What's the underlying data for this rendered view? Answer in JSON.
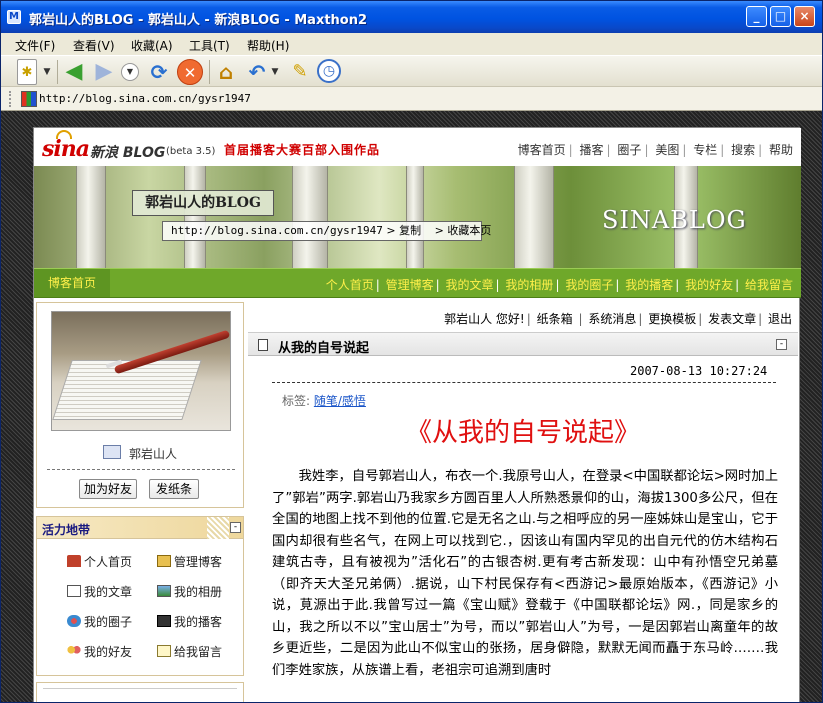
{
  "window": {
    "title": "郭岩山人的BLOG - 郭岩山人 - 新浪BLOG - Maxthon2",
    "app_icon": "maxthon-icon",
    "minimize": "_",
    "maximize": "□",
    "close": "×"
  },
  "menu": [
    "文件(F)",
    "查看(V)",
    "收藏(A)",
    "工具(T)",
    "帮助(H)"
  ],
  "toolbar": {
    "icons": [
      "new-tab-icon",
      "back-icon",
      "forward-icon",
      "dropdown-icon",
      "refresh-icon",
      "stop-icon",
      "home-icon",
      "undo-icon",
      "magic-wand-icon",
      "clock-icon"
    ]
  },
  "address": {
    "url": "http://blog.sina.com.cn/gysr1947"
  },
  "sina": {
    "logo": "sina",
    "product": "新浪 BLOG",
    "beta": "(beta 3.5)",
    "promo": "首届播客大赛百部入围作品",
    "topnav": [
      "博客首页",
      "播客",
      "圈子",
      "美图",
      "专栏",
      "搜索",
      "帮助"
    ]
  },
  "banner": {
    "blog_title": "郭岩山人的BLOG",
    "url": "http://blog.sina.com.cn/gysr1947",
    "copy_label": "> 复制",
    "bookmark_label": "> 收藏本页",
    "brand": "SINABLOG"
  },
  "green_nav": {
    "home": "博客首页",
    "items": [
      "个人首页",
      "管理博客",
      "我的文章",
      "我的相册",
      "我的圈子",
      "我的播客",
      "我的好友",
      "给我留言"
    ]
  },
  "profile": {
    "name": "郭岩山人",
    "add_friend": "加为好友",
    "send_note": "发纸条"
  },
  "huoli": {
    "title": "活力地带",
    "collapse": "-",
    "links": [
      {
        "label": "个人首页",
        "icon": "home-icon"
      },
      {
        "label": "管理博客",
        "icon": "manage-icon"
      },
      {
        "label": "我的文章",
        "icon": "article-icon"
      },
      {
        "label": "我的相册",
        "icon": "photo-icon"
      },
      {
        "label": "我的圈子",
        "icon": "circle-icon"
      },
      {
        "label": "我的播客",
        "icon": "video-icon"
      },
      {
        "label": "我的好友",
        "icon": "friends-icon"
      },
      {
        "label": "给我留言",
        "icon": "message-icon"
      }
    ]
  },
  "userbar": {
    "greeting": "郭岩山人 您好!",
    "items": [
      "纸条箱",
      "系统消息",
      "更换模板",
      "发表文章",
      "退出"
    ]
  },
  "article": {
    "header_title": "从我的自号说起",
    "collapse": "-",
    "date": "2007-08-13 10:27:24",
    "tag_label": "标签:",
    "tag": "随笔/感悟",
    "big_title": "《从我的自号说起》",
    "body": "我姓李，自号郭岩山人，布衣一个.我原号山人，在登录<中国联都论坛>网时加上了”郭岩”两字.郭岩山乃我家乡方圆百里人人所熟悉景仰的山，海拔1300多公尺，但在全国的地图上找不到他的位置.它是无名之山.与之相呼应的另一座姊妹山是宝山，它于国内却很有些名气，在网上可以找到它.，因该山有国内罕见的出自元代的仿木结构石建筑古寺，且有被视为”活化石”的古银杏树.更有考古新发现：山中有孙悟空兄弟墓（即齐天大圣兄弟俩）.据说，山下村民保存有<西游记>最原始版本，《西游记》小说，莧源出于此.我曾写过一篇《宝山赋》登载于《中国联都论坛》网.，同是家乡的山，我之所以不以”宝山居士”为号，而以”郭岩山人”为号，一是因郭岩山离童年的故乡更近些，二是因为此山不似宝山的张扬，居身僻隐，默默无闻而矗于东马岭.……我们李姓家族，从族谱上看，老祖宗可追溯到唐时"
  },
  "colors": {
    "title_bar": "#0053e1",
    "sina_red": "#d00000",
    "nav_green": "#6fa82a",
    "nav_text": "#fff04a",
    "article_title": "#e01010",
    "link": "#1a55c8"
  }
}
